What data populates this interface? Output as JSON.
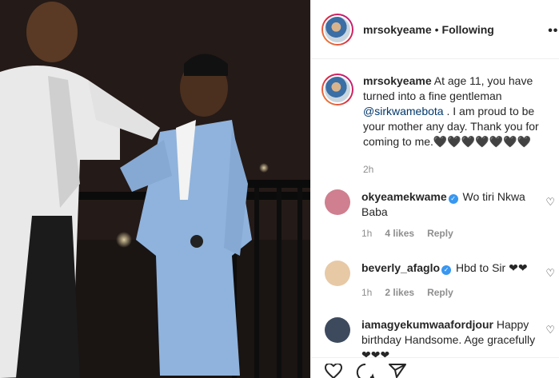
{
  "post": {
    "username": "mrsokyeame",
    "follow_separator": "•",
    "follow_status": "Following",
    "caption_user": "mrsokyeame",
    "caption_pre": "At age 11, you have turned into a fine gentleman",
    "mention": "@sirkwamebota",
    "caption_post": ". I am proud to be your mother any day. Thank you for coming to me.🖤🖤🖤🖤🖤🖤🖤",
    "time": "2h"
  },
  "comments": [
    {
      "user": "okyeamekwame",
      "verified": true,
      "text": "Wo tiri Nkwa Baba",
      "time": "1h",
      "likes": "4 likes",
      "reply": "Reply",
      "avatar_color": "#cf7f8f"
    },
    {
      "user": "beverly_afaglo",
      "verified": true,
      "text": "Hbd to Sir ❤❤",
      "time": "1h",
      "likes": "2 likes",
      "reply": "Reply",
      "avatar_color": "#e7c9a6"
    },
    {
      "user": "iamagyekumwaafordjour",
      "verified": false,
      "text": "Happy birthday Handsome. Age gracefully ❤❤❤",
      "avatar_color": "#3d4a5e"
    }
  ],
  "icons": {
    "more": "more-horizontal-icon",
    "like": "heart-icon",
    "comment": "comment-icon",
    "share": "share-icon",
    "verified": "verified-badge-icon"
  },
  "colors": {
    "mention": "#00376b",
    "verified": "#3897f0",
    "muted": "#8e8e8e",
    "heart": "#ed4956"
  }
}
